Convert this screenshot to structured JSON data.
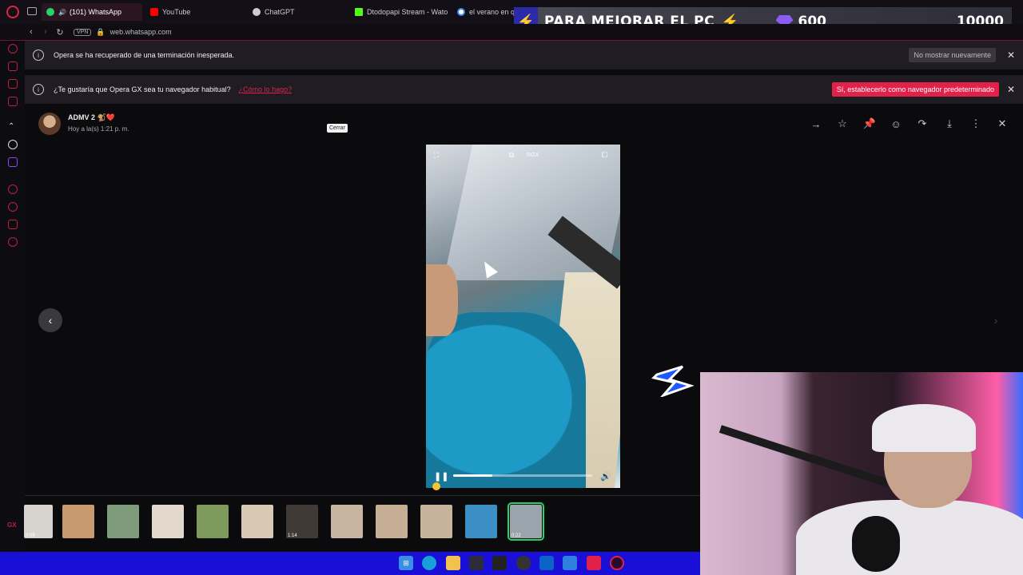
{
  "tabs": [
    {
      "label": "(101) WhatsApp",
      "color": "#25d366",
      "active": true
    },
    {
      "label": "YouTube",
      "color": "#ff0000"
    },
    {
      "label": "ChatGPT",
      "color": "#cccccc"
    },
    {
      "label": "Dtodopapi Stream - Wato",
      "color": "#53fc18"
    },
    {
      "label": "el verano en qu",
      "color": "#4285f4"
    }
  ],
  "stream_banner": {
    "text": "PARA MEJORAR EL PC",
    "gems": "600",
    "goal": "10000"
  },
  "address": {
    "vpn": "VPN",
    "url": "web.whatsapp.com"
  },
  "notices": {
    "crash_text": "Opera se ha recuperado de una terminación inesperada.",
    "crash_button": "No mostrar nuevamente",
    "default_text": "¿Te gustaría que Opera GX sea tu navegador habitual?",
    "default_link": "¿Cómo lo hago?",
    "default_button": "Sí, establecerlo como navegador predeterminado"
  },
  "viewer": {
    "sender": "ADMV 2",
    "sender_emoji": "🐒❤️",
    "time": "Hoy a la(s) 1:21 p. m.",
    "tooltip": "Cerrar",
    "video_badge": "RGX",
    "progress": 0.28
  },
  "thumbnails": [
    {
      "dur": "0:09",
      "color": "#d7d3cf"
    },
    {
      "dur": "",
      "color": "#c79a6f"
    },
    {
      "dur": "",
      "color": "#7e9c7a"
    },
    {
      "dur": "",
      "color": "#e3d8cc"
    },
    {
      "dur": "",
      "color": "#7d9a5c"
    },
    {
      "dur": "",
      "color": "#d8c9b5"
    },
    {
      "dur": "1:14",
      "color": "#3f3a35"
    },
    {
      "dur": "",
      "color": "#c8b5a1"
    },
    {
      "dur": "",
      "color": "#c5ae95"
    },
    {
      "dur": "",
      "color": "#c7b39c"
    },
    {
      "dur": "",
      "color": "#3c8fc4"
    },
    {
      "dur": "0:22",
      "color": "#9aa4ad",
      "selected": true
    }
  ],
  "sidebar_gx": "GX"
}
